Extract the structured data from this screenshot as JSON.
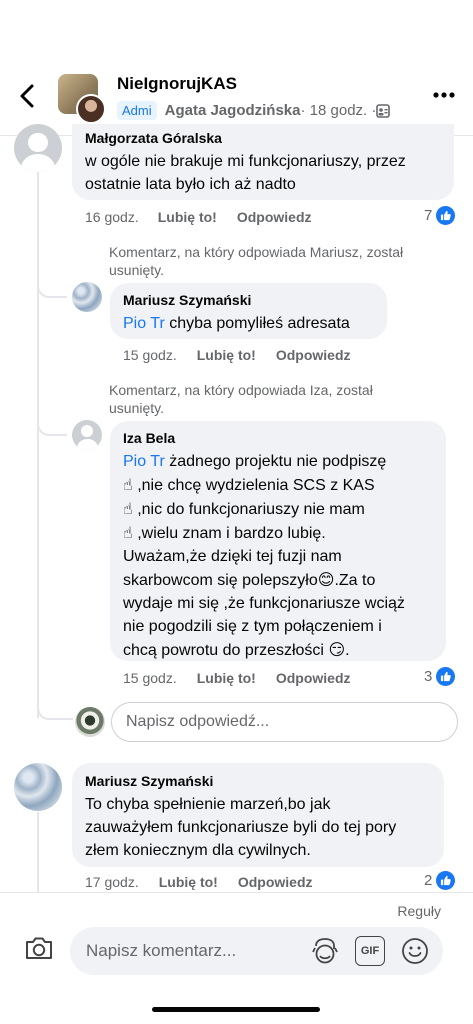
{
  "header": {
    "group_name": "NieIgnorujKAS",
    "badge": "Admi",
    "author": "Agata Jagodzińska",
    "time": " · 18 godz. · "
  },
  "comments": [
    {
      "name": "Małgorzata Góralska",
      "text_lines": [
        "w ogóle nie brakuje mi funkcjonariuszy, przez",
        "ostatnie lata było ich aż nadto"
      ],
      "time": "16 godz.",
      "like": "Lubię to!",
      "reply": "Odpowiedz",
      "reactions": "7"
    },
    {
      "deleted_lines": [
        "Komentarz, na który odpowiada Mariusz, został",
        "usunięty."
      ],
      "name": "Mariusz Szymański",
      "tag": "Pio Tr",
      "text": " chyba pomyliłeś adresata",
      "time": "15 godz.",
      "like": "Lubię to!",
      "reply": "Odpowiedz"
    },
    {
      "deleted_lines": [
        "Komentarz, na który odpowiada Iza, został",
        "usunięty."
      ],
      "name": "Iza Bela",
      "tag": "Pio Tr",
      "line1": " żadnego projektu nie podpiszę",
      "emoji_point": "☝",
      "line2": ",nie chcę wydzielenia SCS z KAS",
      "line3": ",nic do funkcjonariuszy nie mam",
      "line4": ",wielu znam i bardzo lubię.",
      "line5": "Uważam,że dzięki tej fuzji nam",
      "line6a": "skarbowcom się polepszyło",
      "emoji_smile": "😊",
      "line6b": ".Za to",
      "line7": "wydaje mi się ,że funkcjonariusze wciąż",
      "line8": "nie pogodzili się z tym połączeniem i",
      "line9a": "chcą powrotu do przeszłości ",
      "emoji_smirk": "😏",
      "line9b": ".",
      "time": "15 godz.",
      "like": "Lubię to!",
      "reply": "Odpowiedz",
      "reactions": "3"
    },
    {
      "name": "Mariusz Szymański",
      "text_lines": [
        "To chyba spełnienie marzeń,bo jak",
        "zauważyłem funkcjonariusze byli do tej pory",
        "złem koniecznym dla cywilnych."
      ],
      "time": "17 godz.",
      "like": "Lubię to!",
      "reply": "Odpowiedz",
      "reactions": "2"
    }
  ],
  "reply_placeholder": "Napisz odpowiedź...",
  "footer": {
    "sort_label": "Reguły",
    "compose_placeholder": "Napisz komentarz...",
    "gif_label": "GIF"
  },
  "colors": {
    "accent": "#1877f2",
    "bubble": "#f0f2f5",
    "muted": "#65676b"
  }
}
